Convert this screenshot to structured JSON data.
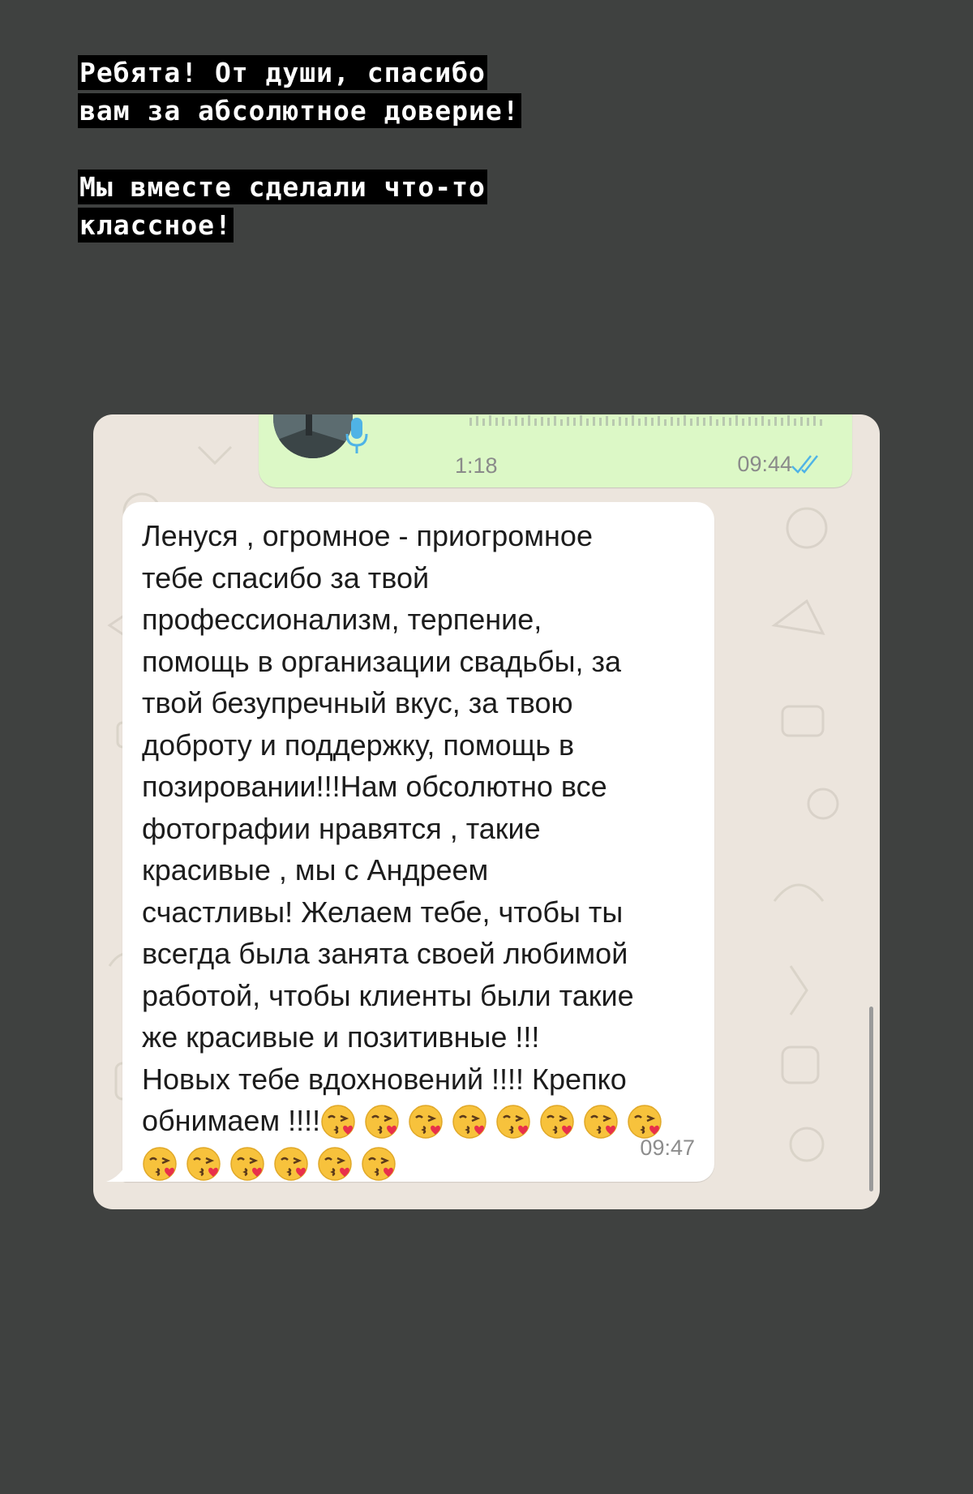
{
  "caption": {
    "paragraph1": [
      "Ребята! От души, спасибо",
      "вам за абсолютное доверие!"
    ],
    "paragraph2": [
      "Мы вместе сделали что-то",
      "классное!"
    ]
  },
  "chat": {
    "voice_message": {
      "duration": "1:18",
      "time": "09:44",
      "status_icon": "double-check-read-icon"
    },
    "text_message": {
      "text": "Ленуся , огромное - приогромное\nтебе спасибо за твой\nпрофессионализм, терпение,\nпомощь в организации свадьбы, за\nтвой безупречный вкус, за твою\nдоброту и поддержку, помощь в\nпозировании!!!Нам обсолютно все\nфотографии нравятся , такие\nкрасивые , мы с Андреем\nсчастливы! Желаем тебе, чтобы ты\nвсегда была занята своей любимой\nработой, чтобы клиенты были такие\nже красивые и позитивные !!!\nНовых тебе вдохновений !!!! Крепко\nобнимаем !!!!",
      "emoji": "😘",
      "emoji_count": 14,
      "time": "09:47"
    }
  },
  "colors": {
    "page_background": "#3f4140",
    "caption_highlight": "#000000",
    "chat_wallpaper": "#ece5dd",
    "outgoing_bubble": "#dcf8c6",
    "incoming_bubble": "#ffffff",
    "read_ticks": "#4fb3e6",
    "mic": "#4fb3e6"
  }
}
